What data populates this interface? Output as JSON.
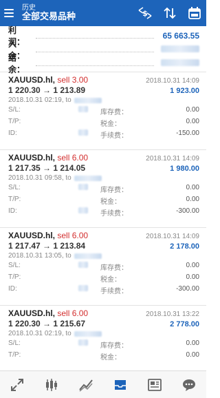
{
  "header": {
    "subtitle": "历史",
    "title": "全部交易品种"
  },
  "icons": {
    "menu": "menu-icon",
    "sort_symbol": "dollar-arrows-icon",
    "sort": "sort-arrows-icon",
    "calendar": "calendar-icon"
  },
  "summary": {
    "profit_label": "利润：",
    "profit_value": "65 663.55",
    "deposit_label": "入金：",
    "balance_label": "结余："
  },
  "labels": {
    "sl": "S/L:",
    "tp": "T/P:",
    "id": "ID:",
    "swap": "库存费：",
    "tax": "税金：",
    "commission": "手续费："
  },
  "trades": [
    {
      "symbol": "XAUUSD.hl,",
      "side": "sell 3.00",
      "date": "2018.10.31 14:09",
      "prices": "1 220.30 → 1 213.89",
      "profit": "1 923.00",
      "open": "2018.10.31 02:19, to",
      "swap": "0.00",
      "tax": "0.00",
      "commission": "-150.00"
    },
    {
      "symbol": "XAUUSD.hl,",
      "side": "sell 6.00",
      "date": "2018.10.31 14:09",
      "prices": "1 217.35 → 1 214.05",
      "profit": "1 980.00",
      "open": "2018.10.31 09:58, to",
      "swap": "0.00",
      "tax": "0.00",
      "commission": "-300.00"
    },
    {
      "symbol": "XAUUSD.hl,",
      "side": "sell 6.00",
      "date": "2018.10.31 14:09",
      "prices": "1 217.47 → 1 213.84",
      "profit": "2 178.00",
      "open": "2018.10.31 13:05, to",
      "swap": "0.00",
      "tax": "0.00",
      "commission": "-300.00"
    },
    {
      "symbol": "XAUUSD.hl,",
      "side": "sell 6.00",
      "date": "2018.10.31 13:22",
      "prices": "1 220.30 → 1 215.67",
      "profit": "2 778.00",
      "open": "2018.10.31 02:19, to",
      "swap": "0.00",
      "tax": "0.00",
      "commission": ""
    }
  ],
  "nav": [
    "trade-icon",
    "chart-candles-icon",
    "chart-line-icon",
    "history-tray-icon",
    "news-icon",
    "chat-icon"
  ],
  "colors": {
    "header_bg": "#1d64ba",
    "sell": "#d32f2f",
    "profit": "#1d64ba"
  }
}
